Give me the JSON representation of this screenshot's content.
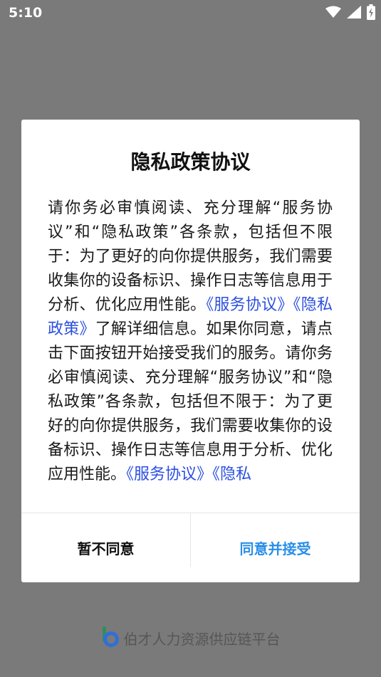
{
  "status_bar": {
    "time": "5:10",
    "icons": [
      "wifi-icon",
      "cell-signal-icon",
      "battery-charging-icon"
    ]
  },
  "dialog": {
    "title": "隐私政策协议",
    "body_segments": [
      {
        "text": "请你务必审慎阅读、充分理解“服务协议”和“隐私政策”各条款，包括但不限于：为了更好的向你提供服务，我们需要收集你的设备标识、操作日志等信息用于分析、优化应用性能。",
        "link": false
      },
      {
        "text": "《服务协议》",
        "link": true
      },
      {
        "text": "《隐私政策》",
        "link": true
      },
      {
        "text": "了解详细信息。如果你同意，请点击下面按钮开始接受我们的服务。请你务必审慎阅读、充分理解“服务协议”和“隐私政策”各条款，包括但不限于：为了更好的向你提供服务，我们需要收集你的设备标识、操作日志等信息用于分析、优化应用性能。",
        "link": false
      },
      {
        "text": "《服务协议》",
        "link": true
      },
      {
        "text": "《隐私",
        "link": true
      }
    ],
    "decline_label": "暂不同意",
    "accept_label": "同意并接受"
  },
  "footer": {
    "logo_icon": "bocai-logo-icon",
    "app_name": "伯才人力资源供应链平台"
  },
  "colors": {
    "overlay": "#7a7a7a",
    "link": "#2b4fe0",
    "accept": "#2a8fe8"
  }
}
